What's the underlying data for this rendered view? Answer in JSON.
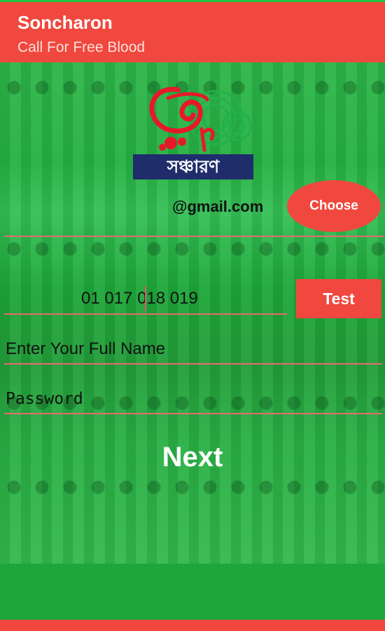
{
  "app_bar": {
    "title": "Soncharon",
    "subtitle": "Call For Free Blood"
  },
  "logo": {
    "text": "সঞ্চারণ"
  },
  "email": {
    "suffix": "@gmail.com",
    "choose_label": "Choose"
  },
  "phone": {
    "value": "01 017 018 019",
    "test_label": "Test"
  },
  "name_field": {
    "placeholder": "Enter Your Full Name"
  },
  "password_field": {
    "placeholder": "Password"
  },
  "next_label": "Next",
  "colors": {
    "app_bar": "#f0483e",
    "background": "#1fb53a",
    "underline": "#e66b6f"
  }
}
